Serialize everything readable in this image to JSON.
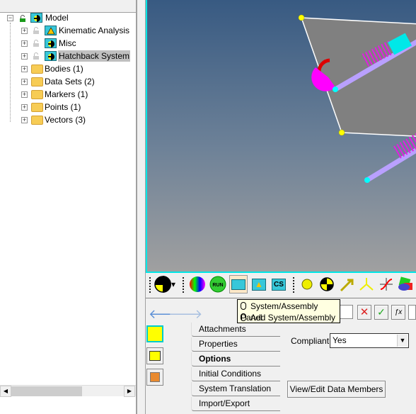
{
  "tree": {
    "root": {
      "label": "Model",
      "icon": "system-icon"
    },
    "systems": [
      {
        "label": "Kinematic Analysis",
        "icon": "analysis-icon"
      },
      {
        "label": "Misc",
        "icon": "system-icon"
      },
      {
        "label": "Hatchback System",
        "icon": "system-icon",
        "selected": true
      }
    ],
    "folders": [
      {
        "label": "Bodies (1)"
      },
      {
        "label": "Data Sets (2)"
      },
      {
        "label": "Markers (1)"
      },
      {
        "label": "Points (1)"
      },
      {
        "label": "Vectors (3)"
      }
    ]
  },
  "toolbar": {
    "icons": [
      "model-icon",
      "color-wheel-icon",
      "run-icon",
      "system-assembly-icon",
      "analysis-icon",
      "coordinate-system-icon",
      "point-icon",
      "body-icon",
      "vector-icon",
      "marker-icon",
      "curve-icon",
      "graphics-icon"
    ],
    "run_label": "RUN",
    "cs_label": "CS"
  },
  "tooltip": {
    "line1": "System/Assembly Panel",
    "line2": "Add System/Assembly"
  },
  "panel": {
    "tabs": [
      "Attachments",
      "Properties",
      "Options",
      "Initial Conditions",
      "System Translation",
      "Import/Export"
    ],
    "active_tab": "Options",
    "compliant_label": "Compliant:",
    "compliant_value": "Yes",
    "view_edit_button": "View/Edit Data Members"
  },
  "colors": {
    "viewport_border": "#00e6e6",
    "selection": "#c0c0c0",
    "tooltip_bg": "#ffffe1"
  }
}
